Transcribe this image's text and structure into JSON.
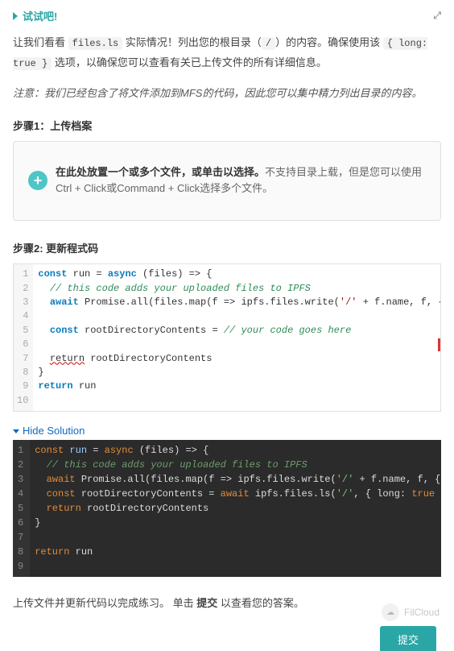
{
  "header": {
    "title": "试试吧!"
  },
  "intro": {
    "prefix": "让我们看看 ",
    "code1": "files.ls",
    "mid1": " 实际情况！列出您的根目录（",
    "code2": "/",
    "mid2": "）的内容。确保使用该 ",
    "code3": "{ long: true }",
    "suffix": " 选项，以确保您可以查看有关已上传文件的所有详细信息。"
  },
  "note": "注意：我们已经包含了将文件添加到MFS的代码，因此您可以集中精力列出目录的内容。",
  "step1": {
    "title": "步骤1：上传档案",
    "upload_bold": "在此处放置一个或多个文件，或单击以选择。",
    "upload_rest": "不支持目录上载，但是您可以使用Ctrl + Click或Command + Click选择多个文件。"
  },
  "step2": {
    "title": "步骤2: 更新程式码"
  },
  "hide_solution": "Hide Solution",
  "footer": {
    "p1": "上传文件并更新代码以完成练习。 单击 ",
    "b": "提交",
    "p2": " 以查看您的答案。"
  },
  "submit_label": "提交",
  "watermark": "FilCloud",
  "chart_data": {
    "type": "table",
    "editor_code": [
      "const run = async (files) => {",
      "  // this code adds your uploaded files to IPFS",
      "  await Promise.all(files.map(f => ipfs.files.write('/' + f.name, f, { c",
      "",
      "  const rootDirectoryContents = // your code goes here",
      "",
      "  return rootDirectoryContents",
      "}",
      "return run",
      ""
    ],
    "solution_code": [
      "const run = async (files) => {",
      "  // this code adds your uploaded files to IPFS",
      "  await Promise.all(files.map(f => ipfs.files.write('/' + f.name, f, { c",
      "  const rootDirectoryContents = await ipfs.files.ls('/', { long: true })",
      "  return rootDirectoryContents",
      "}",
      "",
      "return run",
      ""
    ]
  }
}
